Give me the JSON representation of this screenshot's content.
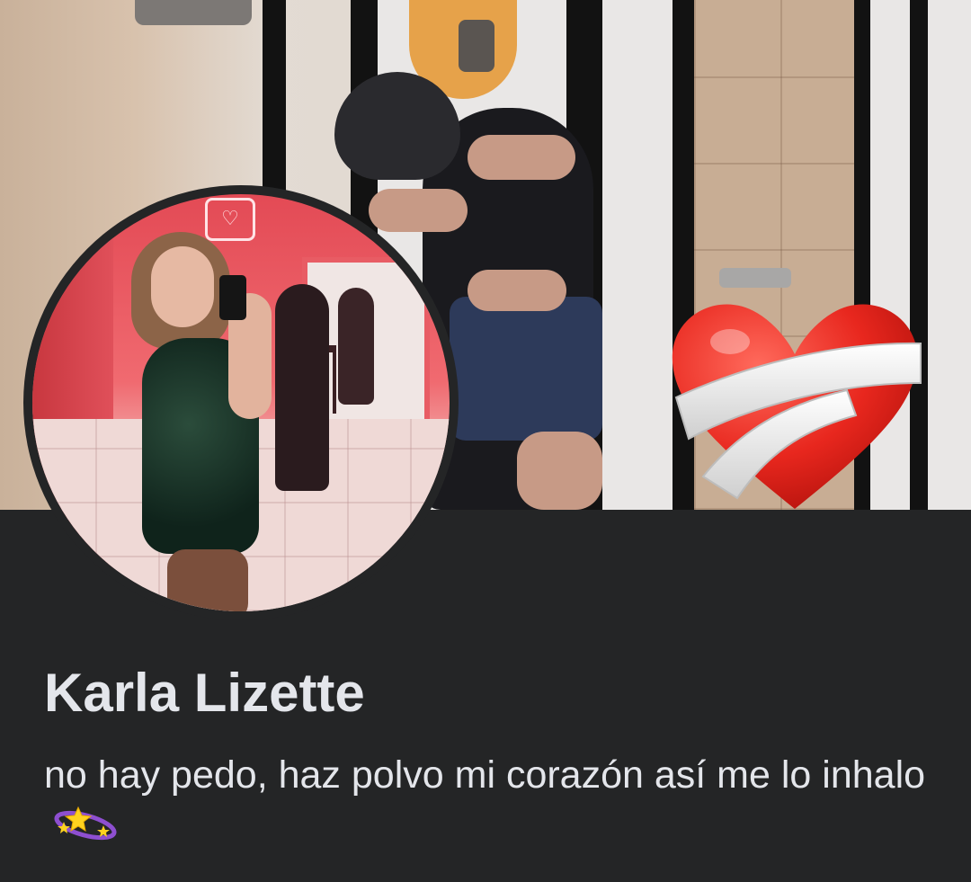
{
  "profile": {
    "name": "Karla Lizette",
    "bio": "no hay pedo, haz polvo mi corazón así me lo inhalo",
    "bio_emoji": "dizzy-emoji"
  },
  "cover_photo": {
    "overlay_emoji": "mending-heart-emoji"
  },
  "profile_picture": {
    "sign_icon": "heart-icon"
  },
  "theme": {
    "background": "#242526",
    "text": "#e4e6eb"
  }
}
